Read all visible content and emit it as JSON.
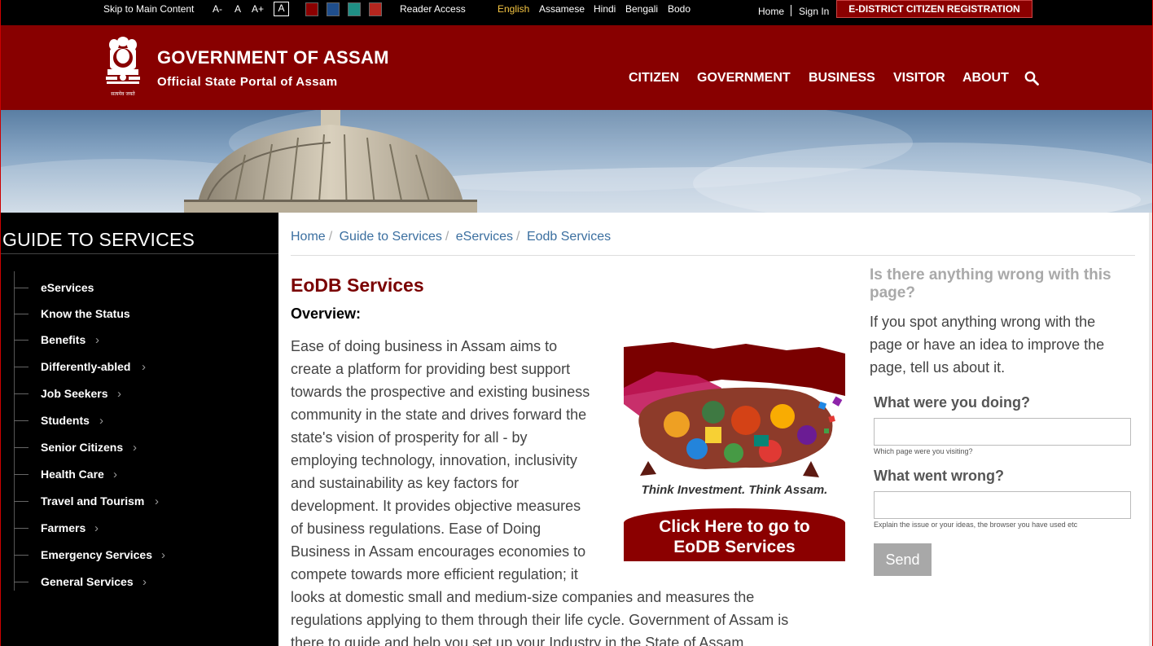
{
  "topbar": {
    "skip": "Skip to Main Content",
    "font_minus": "A-",
    "font_normal": "A",
    "font_plus": "A+",
    "font_contrast": "A",
    "reader_access": "Reader Access",
    "languages": [
      "English",
      "Assamese",
      "Hindi",
      "Bengali",
      "Bodo"
    ],
    "home": "Home",
    "sign_in": "Sign In",
    "registration": "E-DISTRICT CITIZEN REGISTRATION",
    "theme_colors": [
      "#8b0000",
      "#1f4e8c",
      "#1f8f85",
      "#b5261e"
    ]
  },
  "header": {
    "title": "GOVERNMENT OF ASSAM",
    "subtitle": "Official State Portal of Assam",
    "emblem_caption": "सत्यमेव जयते",
    "nav": [
      "CITIZEN",
      "GOVERNMENT",
      "BUSINESS",
      "VISITOR",
      "ABOUT"
    ],
    "search_icon": "search-icon"
  },
  "sidebar": {
    "title": "GUIDE TO SERVICES",
    "items": [
      {
        "label": "eServices",
        "has_children": false
      },
      {
        "label": "Know the Status",
        "has_children": false
      },
      {
        "label": "Benefits",
        "has_children": true
      },
      {
        "label": "Differently-abled",
        "has_children": true
      },
      {
        "label": "Job Seekers",
        "has_children": true
      },
      {
        "label": "Students",
        "has_children": true
      },
      {
        "label": "Senior Citizens",
        "has_children": true
      },
      {
        "label": "Health Care",
        "has_children": true
      },
      {
        "label": "Travel and Tourism",
        "has_children": true
      },
      {
        "label": "Farmers",
        "has_children": true
      },
      {
        "label": "Emergency Services",
        "has_children": true
      },
      {
        "label": "General Services",
        "has_children": true
      }
    ],
    "chevron": "›"
  },
  "breadcrumb": [
    "Home",
    "Guide to Services",
    "eServices",
    "Eodb Services"
  ],
  "main": {
    "title": "EoDB Services",
    "overview_heading": "Overview:",
    "paragraph_lines": [
      "Ease of doing business in Assam aims to",
      "create a platform for providing best support",
      "towards the prospective and existing business",
      "community in the state and drives forward the",
      "state's vision of prosperity for all - by",
      "employing technology, innovation, inclusivity",
      "and sustainability as key factors for",
      "development. It provides objective measures",
      "of business regulations. Ease of Doing",
      "Business in Assam encourages economies to",
      "compete towards more efficient regulation; it",
      "looks at domestic small and medium-size companies and measures the",
      "regulations applying to them through their life cycle. Government of Assam is",
      "there to guide and help you set up your Industry in the State of Assam."
    ],
    "promo": {
      "tagline": "Think Investment. Think Assam.",
      "button_line1": "Click Here to go to",
      "button_line2": "EoDB Services"
    }
  },
  "feedback": {
    "question": "Is there anything wrong with this page?",
    "intro": "If you spot anything wrong with the page or have an idea to improve the page, tell us about it.",
    "doing_label": "What were you doing?",
    "doing_hint": "Which page were you visiting?",
    "wrong_label": "What went wrong?",
    "wrong_hint": "Explain the issue or your ideas, the browser you have used etc",
    "send": "Send"
  }
}
